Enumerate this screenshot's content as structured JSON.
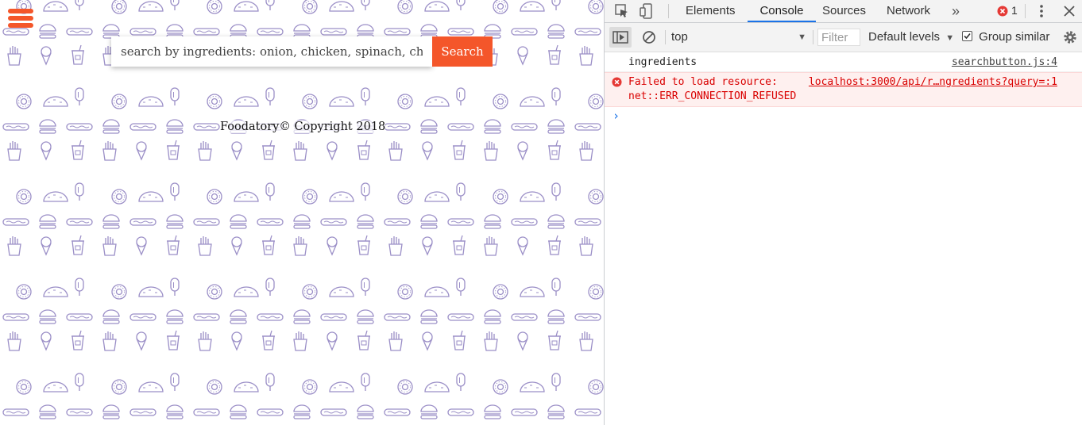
{
  "page": {
    "brand_color": "#f4562a",
    "pattern_color": "#9b8fc7",
    "menu_icon": "hamburger-menu-icon",
    "search": {
      "value": "",
      "placeholder": "search by ingredients: onion, chicken, spinach, cheese",
      "button_label": "Search"
    },
    "footer_text": "Foodatory© Copyright 2018",
    "pattern_icons": [
      "donut-icon",
      "taco-icon",
      "popsicle-icon",
      "hotdog-icon",
      "burger-icon",
      "ice-cream-icon",
      "soda-cup-icon",
      "fries-icon"
    ]
  },
  "devtools": {
    "tabs": [
      "Elements",
      "Console",
      "Sources",
      "Network"
    ],
    "active_tab": "Console",
    "more_tabs_icon": "chevron-double-right-icon",
    "error_count": "1",
    "toolbar": {
      "context": "top",
      "filter_placeholder": "Filter",
      "levels_label": "Default levels",
      "group_similar_label": "Group similar",
      "group_similar_checked": true
    },
    "messages": [
      {
        "level": "log",
        "text": "ingredients",
        "source": "searchbutton.js:4"
      },
      {
        "level": "error",
        "text": "Failed to load resource:",
        "source": "localhost:3000/api/r…ngredients?query=:1",
        "detail": "net::ERR_CONNECTION_REFUSED"
      }
    ],
    "prompt_icon": "console-prompt-icon",
    "accent_color": "#1a73e8",
    "error_color": "#d90000"
  }
}
